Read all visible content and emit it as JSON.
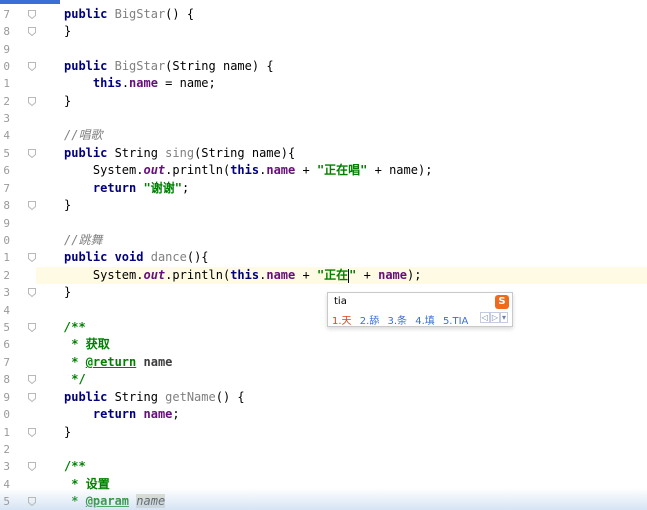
{
  "line_numbers": [
    "7",
    "8",
    "9",
    "0",
    "1",
    "2",
    "3",
    "4",
    "5",
    "6",
    "7",
    "8",
    "9",
    "0",
    "1",
    "2",
    "3",
    "4",
    "5",
    "6",
    "7",
    "8",
    "9",
    "0",
    "1",
    "2",
    "3",
    "4",
    "5"
  ],
  "code": {
    "l1_kw": "public",
    "l1_name": "BigStar",
    "l1_rest": "() {",
    "l2": "}",
    "l4_kw": "public",
    "l4_name": "BigStar",
    "l4_rest": "(String name) {",
    "l5_this": "this",
    "l5_field": "name",
    "l5_rest": " = name;",
    "l6": "}",
    "l8_comment": "//唱歌",
    "l9_kw": "public",
    "l9_type": " String ",
    "l9_name": "sing",
    "l9_rest": "(String name){",
    "l10_a": "System.",
    "l10_out": "out",
    "l10_b": ".println(",
    "l10_this": "this",
    "l10_field": "name",
    "l10_c": " + ",
    "l10_str": "\"正在唱\"",
    "l10_d": " + name);",
    "l11_kw": "return",
    "l11_str": "\"谢谢\"",
    "l11_end": ";",
    "l12": "}",
    "l14_comment": "//跳舞",
    "l15_kw": "public",
    "l15_void": " void ",
    "l15_name": "dance",
    "l15_rest": "(){",
    "l16_a": "System.",
    "l16_out": "out",
    "l16_b": ".println(",
    "l16_this": "this",
    "l16_field": "name",
    "l16_c": " + ",
    "l16_str": "\"正在",
    "l16_str2": "\"",
    "l16_d": " + ",
    "l16_name": "name",
    "l16_e": ");",
    "l17": "}",
    "l19": "/**",
    "l20_star": " * ",
    "l20_text": "获取",
    "l21_star": " * ",
    "l21_tag": "@return",
    "l21_name": "name",
    "l22": " */",
    "l23_kw": "public",
    "l23_type": " String ",
    "l23_name": "getName",
    "l23_rest": "() {",
    "l24_kw": "return",
    "l24_field": "name",
    "l24_end": ";",
    "l25": "}",
    "l27": "/**",
    "l28_star": " * ",
    "l28_text": "设置",
    "l29_star": " * ",
    "l29_tag": "@param",
    "l29_name": "name"
  },
  "ime": {
    "input": "tia",
    "logo": "S",
    "candidates": [
      "1.天",
      "2.舔",
      "3.条",
      "4.填",
      "5.TIA"
    ],
    "nav_prev": "◁",
    "nav_next": "▷",
    "nav_more": "▾"
  }
}
